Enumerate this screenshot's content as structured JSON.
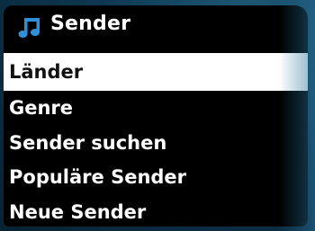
{
  "header": {
    "title": "Sender",
    "icon": "music-note-icon",
    "icon_color": "#2f8fd8"
  },
  "menu": {
    "items": [
      {
        "label": "Länder",
        "selected": true
      },
      {
        "label": "Genre",
        "selected": false
      },
      {
        "label": "Sender suchen",
        "selected": false
      },
      {
        "label": "Populäre Sender",
        "selected": false
      },
      {
        "label": "Neue Sender",
        "selected": false
      }
    ]
  },
  "colors": {
    "background": "#000000",
    "text": "#ffffff",
    "selection_background": "#ffffff",
    "selection_text": "#111111"
  }
}
